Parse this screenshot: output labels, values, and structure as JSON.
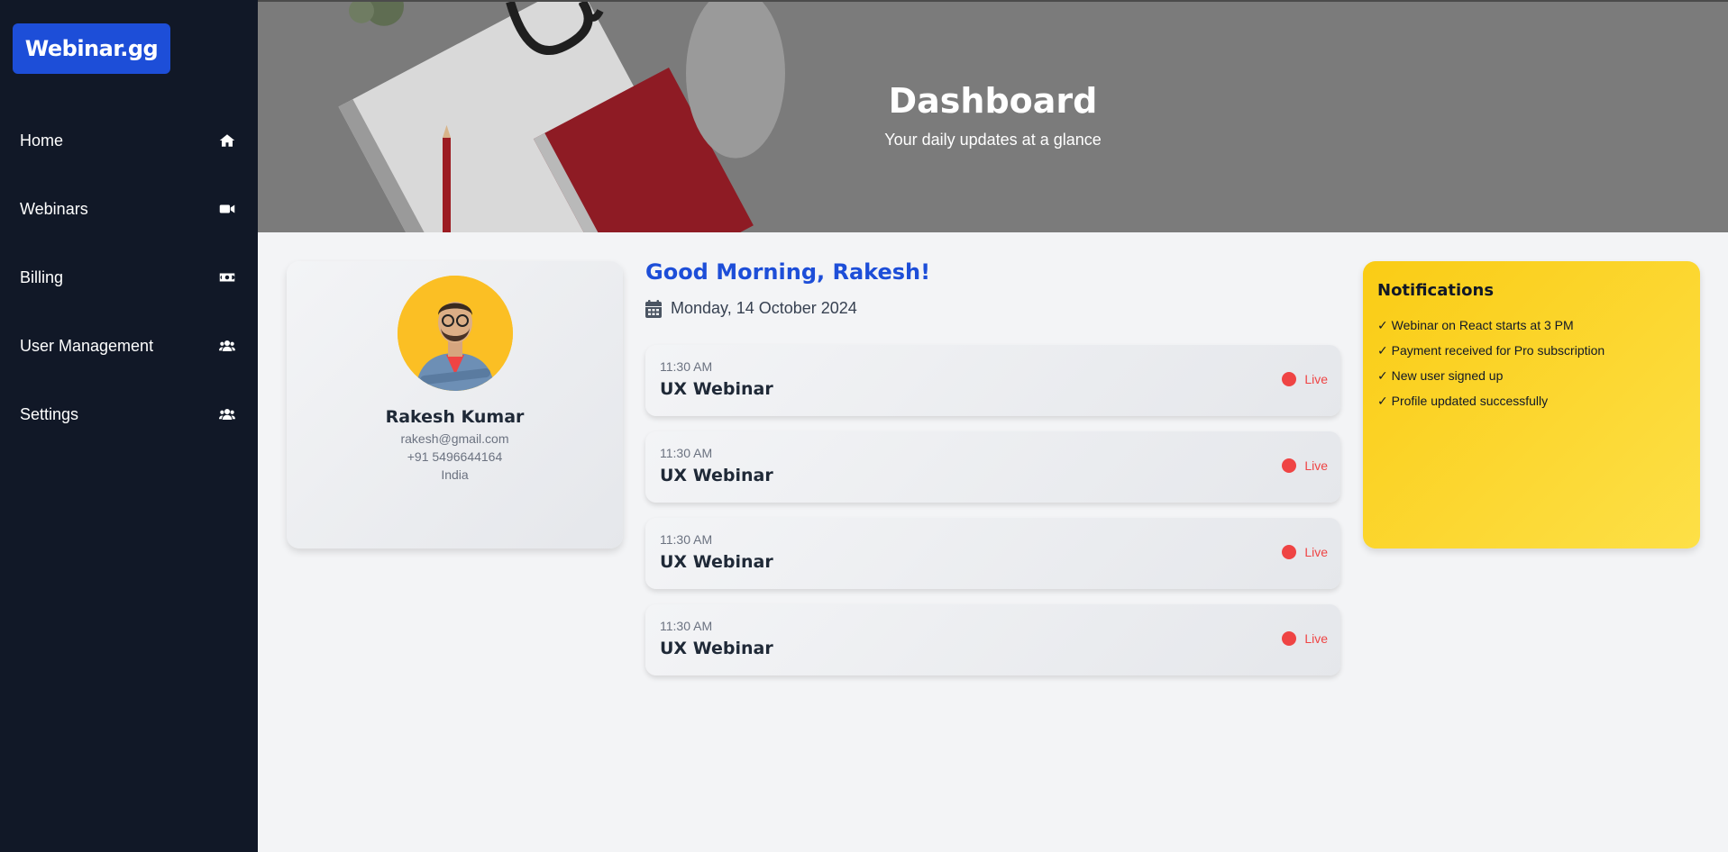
{
  "sidebar": {
    "logo": "Webinar.gg",
    "items": [
      {
        "label": "Home",
        "icon": "home-icon"
      },
      {
        "label": "Webinars",
        "icon": "video-camera-icon"
      },
      {
        "label": "Billing",
        "icon": "money-bill-icon"
      },
      {
        "label": "User Management",
        "icon": "users-icon"
      },
      {
        "label": "Settings",
        "icon": "users-icon"
      }
    ]
  },
  "hero": {
    "title": "Dashboard",
    "subtitle": "Your daily updates at a glance"
  },
  "profile": {
    "name": "Rakesh Kumar",
    "email": "rakesh@gmail.com",
    "phone": "+91 5496644164",
    "country": "India"
  },
  "main": {
    "greeting": "Good Morning, Rakesh!",
    "date": "Monday, 14 October 2024",
    "webinars": [
      {
        "time": "11:30 AM",
        "title": "UX Webinar",
        "status": "Live"
      },
      {
        "time": "11:30 AM",
        "title": "UX Webinar",
        "status": "Live"
      },
      {
        "time": "11:30 AM",
        "title": "UX Webinar",
        "status": "Live"
      },
      {
        "time": "11:30 AM",
        "title": "UX Webinar",
        "status": "Live"
      }
    ]
  },
  "notifications": {
    "title": "Notifications",
    "items": [
      "✓ Webinar on React starts at 3 PM",
      "✓ Payment received for Pro subscription",
      "✓ New user signed up",
      "✓ Profile updated successfully"
    ]
  },
  "colors": {
    "sidebar_bg": "#111827",
    "accent": "#1d4ed8",
    "live": "#ef4444",
    "notification_bg": "#facc15"
  }
}
